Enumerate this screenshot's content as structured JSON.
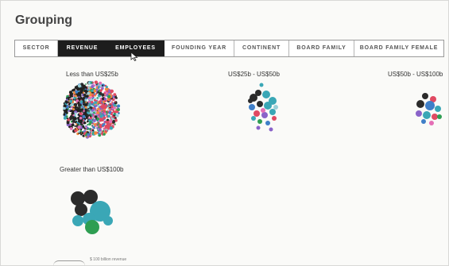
{
  "heading": "Grouping",
  "tabs": [
    {
      "label": "SECTOR",
      "active": false
    },
    {
      "label": "REVENUE",
      "active": true
    },
    {
      "label": "EMPLOYEES",
      "active": true
    },
    {
      "label": "FOUNDING YEAR",
      "active": false
    },
    {
      "label": "CONTINENT",
      "active": false
    },
    {
      "label": "BOARD FAMILY",
      "active": false
    },
    {
      "label": "BOARD FAMILY FEMALE",
      "active": false
    }
  ],
  "groups": [
    {
      "label": "Less than US$25b"
    },
    {
      "label": "US$25b - US$50b"
    },
    {
      "label": "US$50b - US$100b"
    },
    {
      "label": "Greater than US$100b"
    }
  ],
  "legend": "$ 100 billion revenue",
  "colors": [
    "#2b2b2b",
    "#3aa7b6",
    "#3f7fc8",
    "#e04a62",
    "#8a63c9",
    "#2e9e52",
    "#e46fb6",
    "#9ad0d8",
    "#f08a3c"
  ]
}
